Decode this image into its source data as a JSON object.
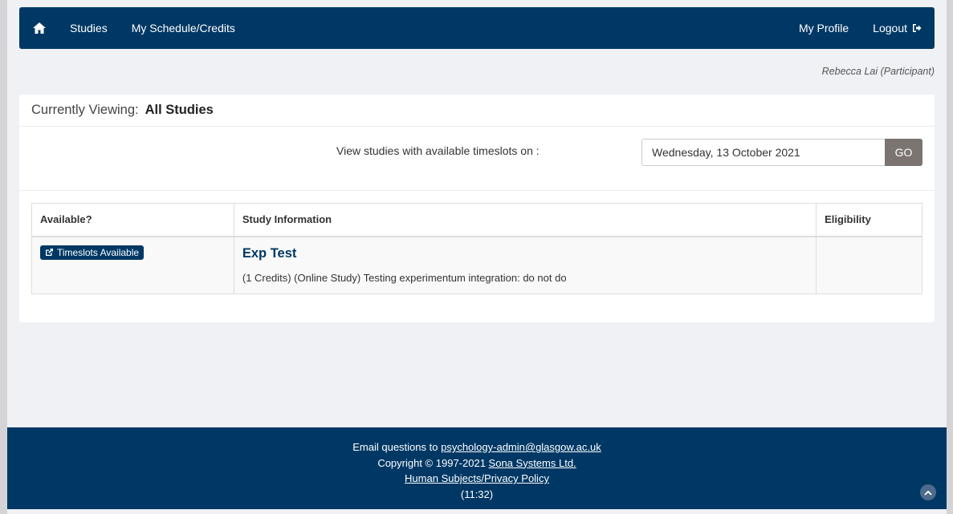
{
  "nav": {
    "home_icon": "home-icon",
    "studies": "Studies",
    "schedule": "My Schedule/Credits",
    "profile": "My Profile",
    "logout": "Logout",
    "logout_icon": "sign-out-icon"
  },
  "user": "Rebecca Lai (Participant)",
  "panel": {
    "viewing_label": "Currently Viewing:",
    "viewing_value": "All Studies",
    "filter_label": "View studies with available timeslots on :",
    "date_value": "Wednesday, 13 October 2021",
    "go_label": "GO"
  },
  "table": {
    "headers": [
      "Available?",
      "Study Information",
      "Eligibility"
    ],
    "rows": [
      {
        "available": "Timeslots Available",
        "available_icon": "external-link-icon",
        "title": "Exp Test",
        "description": "(1 Credits) (Online Study) Testing experimentum integration: do not do",
        "eligibility": ""
      }
    ]
  },
  "footer": {
    "email_prefix": "Email questions to ",
    "email": "psychology-admin@glasgow.ac.uk",
    "copyright_prefix": "Copyright © 1997-2021 ",
    "company": "Sona Systems Ltd.",
    "privacy": "Human Subjects/Privacy Policy",
    "time": "(11:32)",
    "scroll_icon": "chevron-up-icon"
  },
  "colors": {
    "brand": "#003865",
    "go_button": "#7b7470",
    "background": "#f0f1f5"
  }
}
